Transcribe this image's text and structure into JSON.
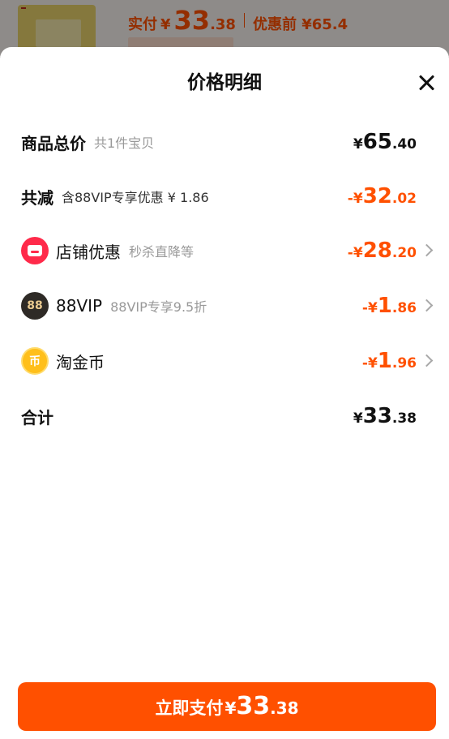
{
  "background": {
    "price_label": "实付",
    "currency": "¥",
    "price_int": "33",
    "price_dec": ".38",
    "original_label": "优惠前 ¥65.4"
  },
  "sheet": {
    "title": "价格明细",
    "rows": {
      "total": {
        "label": "商品总价",
        "note": "共1件宝贝",
        "currency": "¥",
        "int": "65",
        "dec": ".40"
      },
      "reduction": {
        "label": "共减",
        "note": "含88VIP专享优惠 ¥ 1.86",
        "currency": "-¥",
        "int": "32",
        "dec": ".02"
      },
      "shop": {
        "icon": "shop-icon",
        "label": "店铺优惠",
        "note": "秒杀直降等",
        "currency": "-¥",
        "int": "28",
        "dec": ".20"
      },
      "vip": {
        "icon": "vip-88-icon",
        "icon_text": "88",
        "label": "88VIP",
        "note": "88VIP专享9.5折",
        "currency": "-¥",
        "int": "1",
        "dec": ".86"
      },
      "coin": {
        "icon": "coin-icon",
        "icon_text": "币",
        "label": "淘金币",
        "note": "",
        "currency": "-¥",
        "int": "1",
        "dec": ".96"
      },
      "sum": {
        "label": "合计",
        "currency": "¥",
        "int": "33",
        "dec": ".38"
      }
    },
    "pay_button": {
      "label": "立即支付",
      "currency": "¥",
      "int": "33",
      "dec": ".38"
    }
  },
  "colors": {
    "accent": "#ff5000",
    "shop_icon": "#ff2a4a",
    "vip_icon": "#2e2a26",
    "coin_icon": "#ffbf1a"
  }
}
